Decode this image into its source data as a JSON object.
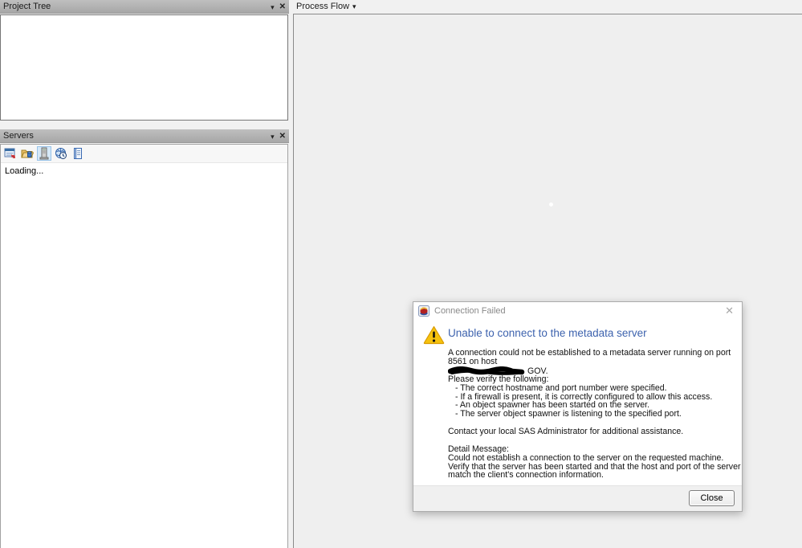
{
  "panels": {
    "project_tree": {
      "title": "Project Tree"
    },
    "servers": {
      "title": "Servers",
      "loading_text": "Loading...",
      "toolbar_icons": [
        "connect-window-icon",
        "library-folder-icon",
        "server-icon",
        "globe-clock-icon",
        "notes-icon"
      ],
      "selected_icon": "server-icon",
      "selected_highlight_color": "#d5e8f8"
    },
    "process_flow": {
      "title": "Process Flow"
    }
  },
  "dialog": {
    "title": "Connection Failed",
    "heading": "Unable to connect to the metadata server",
    "message_line": "A connection could not be established to a metadata server running on port 8561 on host",
    "redacted_host_suffix": "GOV.",
    "verify_heading": "Please verify the following:",
    "verify_items": [
      "- The correct hostname and port number were specified.",
      "- If a firewall is present, it is correctly configured to allow this access.",
      "- An object spawner has been started on the server.",
      "- The server object spawner is listening to the specified port."
    ],
    "contact_text": "Contact your local SAS Administrator for additional assistance.",
    "detail_label": "Detail Message:",
    "detail_text": "Could not establish a connection to the server on the requested machine.  Verify that the server has been started and that the host and port of the server match the client's connection information.",
    "close_label": "Close",
    "close_glyph": "✕",
    "colors": {
      "heading_blue": "#3e63ae",
      "warning_yellow": "#f6c20e",
      "port": "8561"
    }
  },
  "glyphs": {
    "dropdown_arrow": "▾",
    "panel_close": "✕"
  }
}
